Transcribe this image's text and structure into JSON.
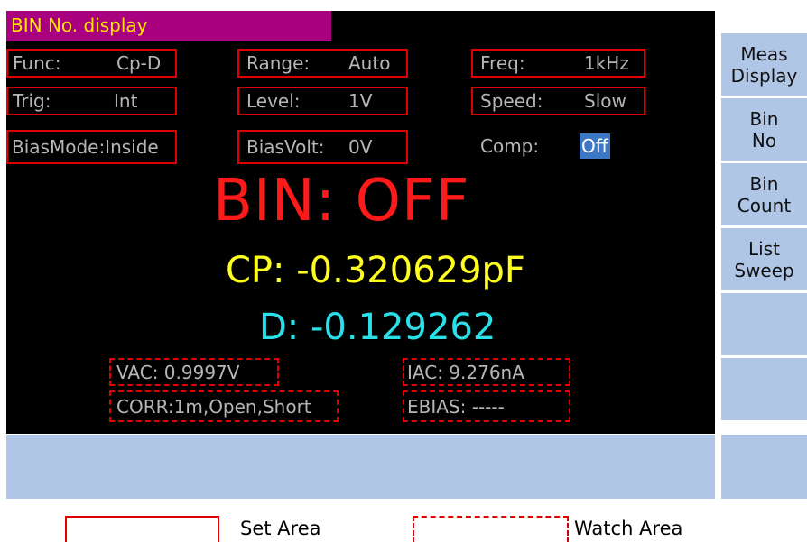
{
  "title": "BIN No. display",
  "set_fields": {
    "func": {
      "label": "Func:",
      "value": "Cp-D"
    },
    "range": {
      "label": "Range:",
      "value": "Auto"
    },
    "freq": {
      "label": "Freq:",
      "value": "1kHz"
    },
    "trig": {
      "label": "Trig:",
      "value": "Int"
    },
    "level": {
      "label": "Level:",
      "value": "1V"
    },
    "speed": {
      "label": "Speed:",
      "value": "Slow"
    },
    "biasmode": {
      "text": "BiasMode:Inside"
    },
    "biasvolt": {
      "label": "BiasVolt:",
      "value": "0V"
    }
  },
  "comp": {
    "label": "Comp:",
    "value": "Off"
  },
  "result": {
    "bin": "BIN: OFF",
    "cp": "CP: -0.320629pF",
    "d": "D: -0.129262"
  },
  "watch_fields": {
    "vac": "VAC:  0.9997V",
    "iac": "IAC:   9.276nA",
    "corr": "CORR:1m,Open,Short",
    "ebias": "EBIAS:  -----"
  },
  "side_buttons": [
    {
      "line1": "Meas",
      "line2": "Display"
    },
    {
      "line1": "Bin",
      "line2": "No"
    },
    {
      "line1": "Bin",
      "line2": "Count"
    },
    {
      "line1": "List",
      "line2": "Sweep"
    },
    {
      "line1": "",
      "line2": ""
    },
    {
      "line1": "",
      "line2": ""
    }
  ],
  "legend": {
    "set_area": "Set Area",
    "watch_area": "Watch Area"
  },
  "colors": {
    "title_bg": "#a8007e",
    "title_text": "#ffe600",
    "bin_text": "#ff1a1a",
    "cp_text": "#ffff1f",
    "d_text": "#2ae0e8",
    "button_bg": "#b0c6e6",
    "box_border": "#e10000"
  }
}
